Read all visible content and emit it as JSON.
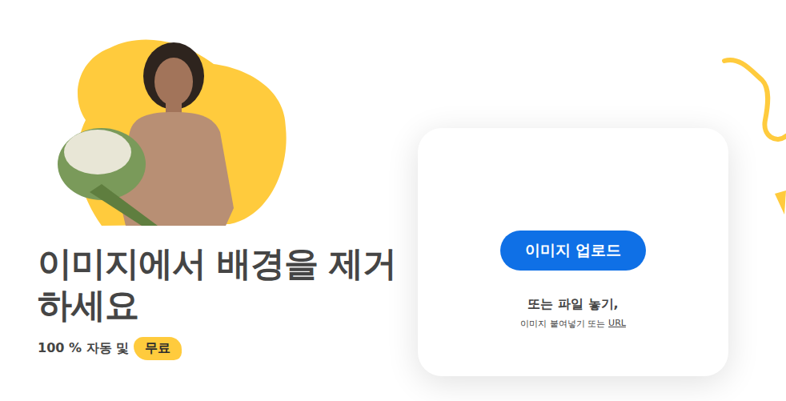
{
  "hero": {
    "title": "이미지에서 배경을 제거하세요",
    "subtitle": "100 % 자동 및",
    "badge": "무료"
  },
  "upload": {
    "button": "이미지 업로드",
    "drop_hint": "또는 파일 놓기,",
    "paste_hint": "이미지 붙여넣기 또는",
    "url_link": "URL"
  }
}
